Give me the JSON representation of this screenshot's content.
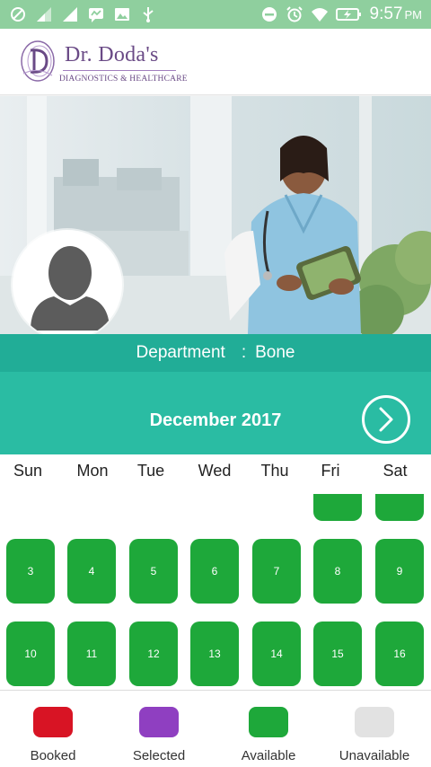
{
  "status_bar": {
    "time": "9:57",
    "ampm": "PM",
    "icons": [
      "blocked-icon",
      "signal-icon",
      "signal-icon",
      "messenger-icon",
      "image-icon",
      "usb-icon",
      "do-not-disturb-icon",
      "alarm-icon",
      "wifi-icon",
      "battery-charging-icon"
    ]
  },
  "header": {
    "brand": "Dr. Doda's",
    "tagline": "DIAGNOSTICS & HEALTHCARE"
  },
  "department": {
    "label": "Department",
    "separator": ":",
    "value": "Bone"
  },
  "calendar": {
    "month_title": "December 2017",
    "weekdays": [
      "Sun",
      "Mon",
      "Tue",
      "Wed",
      "Thu",
      "Fri",
      "Sat"
    ],
    "week2": [
      "3",
      "4",
      "5",
      "6",
      "7",
      "8",
      "9"
    ],
    "week3": [
      "10",
      "11",
      "12",
      "13",
      "14",
      "15",
      "16"
    ]
  },
  "legend": {
    "booked": "Booked",
    "selected": "Selected",
    "available": "Available",
    "unavailable": "Unavailable"
  },
  "colors": {
    "status_bar": "#8fcf9e",
    "department_bar": "#21ad97",
    "month_bar": "#2abca3",
    "available": "#1ea83a",
    "booked": "#d81424",
    "selected": "#8f3fc1",
    "unavailable": "#e2e2e2",
    "brand_purple": "#6a4a86"
  }
}
